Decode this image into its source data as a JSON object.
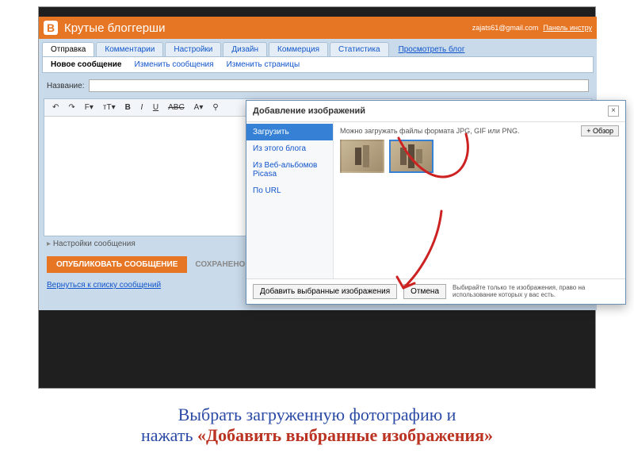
{
  "header": {
    "logo_letter": "B",
    "site_title": "Крутые блоггерши",
    "user_email": "zajats61@gmail.com",
    "panel_link": "Панель инстру"
  },
  "tabs": [
    "Отправка",
    "Комментарии",
    "Настройки",
    "Дизайн",
    "Коммерция",
    "Статистика"
  ],
  "preview_link": "Просмотреть блог",
  "subtabs": [
    "Новое сообщение",
    "Изменить сообщения",
    "Изменить страницы"
  ],
  "form": {
    "title_label": "Название:",
    "title_value": ""
  },
  "toolbar": {
    "undo": "↶",
    "redo": "↷",
    "font": "F▾",
    "size": "тТ▾",
    "bold": "B",
    "italic": "I",
    "underline": "U",
    "strike": "ABC",
    "color": "A▾",
    "link": "⚲"
  },
  "settings_link": "Настройки сообщения",
  "publish_button": "ОПУБЛИКОВАТЬ СООБЩЕНИЕ",
  "saved_label": "СОХРАНЕНО",
  "back_link": "Вернуться к списку сообщений",
  "modal": {
    "title": "Добавление изображений",
    "close": "×",
    "sidebar": [
      "Загрузить",
      "Из этого блога",
      "Из Веб-альбомов Picasa",
      "По URL"
    ],
    "hint": "Можно загружать файлы формата JPG, GIF или PNG.",
    "browse": "+ Обзор",
    "add_button": "Добавить выбранные изображения",
    "cancel_button": "Отмена",
    "note": "Выбирайте только те изображения, право на использование которых у вас есть."
  },
  "caption": {
    "line1": "Выбрать загруженную фотографию и",
    "line2_a": "нажать ",
    "line2_b": "«Добавить выбранные изображения»"
  }
}
